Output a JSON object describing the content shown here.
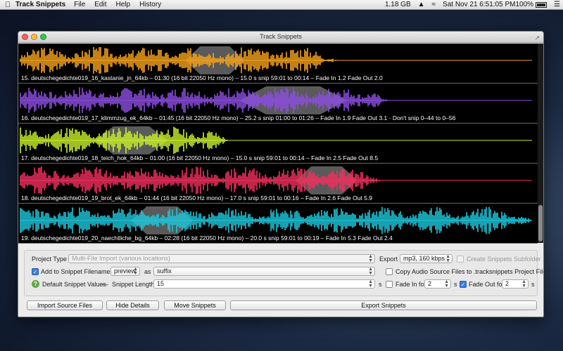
{
  "menubar": {
    "app_name": "Track Snippets",
    "menus": [
      "File",
      "Edit",
      "Help",
      "History"
    ],
    "status": {
      "memory": "1.18 GB",
      "battery": "100%",
      "clock": "Sat Nov 21  6:51:05 PM"
    }
  },
  "window": {
    "title": "Track Snippets"
  },
  "tracks": [
    {
      "label": "15. deutschegedichte019_16_kastanie_jn_64kb – 01:30 (16 bit 22050 Hz mono) – 15.0 s snip 59:01 to 00:14 – Fade In 1.2 Fade Out 2.0",
      "color": "#f5a21b",
      "wave_end": 0.62,
      "snip_start": 0.325,
      "snip_end": 0.44,
      "seed": 3
    },
    {
      "label": "16. deutschegedichte019_17_klimmzug_ek_64kb – 01:45 (16 bit 22050 Hz mono) – 25.2 s snip 01:00 to 01:26 – Fade In 1.9 Fade Out 3.1 · Don't snip 0–44 to 0–56",
      "color": "#8c4de0",
      "wave_end": 0.72,
      "snip_start": 0.43,
      "snip_end": 0.64,
      "seed": 7
    },
    {
      "label": "17. deutschegedichte019_18_teich_hok_64kb – 01:00 (16 bit 22050 Hz mono) – 15.0 s snip 59:01 to 00:14 – Fade In 2.5 Fade Out 8.5",
      "color": "#c8f02a",
      "wave_end": 0.41,
      "snip_start": 0.15,
      "snip_end": 0.29,
      "seed": 11
    },
    {
      "label": "18. deutschegedichte019_19_brot_ek_64kb – 01:44 (16 bit 22050 Hz mono) – 17.0 s snip 59:01 to 00:16 – Fade In 2.6 Fade Out 5.9",
      "color": "#f0305e",
      "wave_end": 0.71,
      "snip_start": 0.54,
      "snip_end": 0.66,
      "seed": 19
    },
    {
      "label": "19. deutschegedichte019_20_naechtliche_bg_64kb – 02:28 (16 bit 22050 Hz mono) – 20.0 s snip 59:01 to 00:19 – Fade In 5.3 Fade Out 2.4",
      "color": "#1ec8dc",
      "wave_end": 1.0,
      "snip_start": 0.22,
      "snip_end": 0.34,
      "seed": 23
    }
  ],
  "controls": {
    "project_type_label": "Project Type",
    "project_type_value": "Multi-File Import (various locations)",
    "export_label": "Export",
    "export_value": "mp3, 160 kbps",
    "create_subfolder_label": "Create Snippets Subfolder",
    "add_to_filenames_label": "Add to Snippet Filenames",
    "filename_word": "preview",
    "as_label": "as",
    "filename_position": "suffix",
    "copy_sources_label": "Copy Audio Source Files to .tracksnippets Project File",
    "default_values_label": "Default Snippet Values",
    "dash": "—",
    "snippet_length_label": "Snippet Length",
    "snippet_length_value": "15",
    "seconds_unit": "s",
    "fade_in_label": "Fade In for",
    "fade_in_value": "2",
    "fade_out_label": "Fade Out for",
    "fade_out_value": "2",
    "help_glyph": "?"
  },
  "buttons": {
    "import": "Import Source Files",
    "hide_details": "Hide Details",
    "move": "Move Snippets",
    "export": "Export Snippets"
  }
}
